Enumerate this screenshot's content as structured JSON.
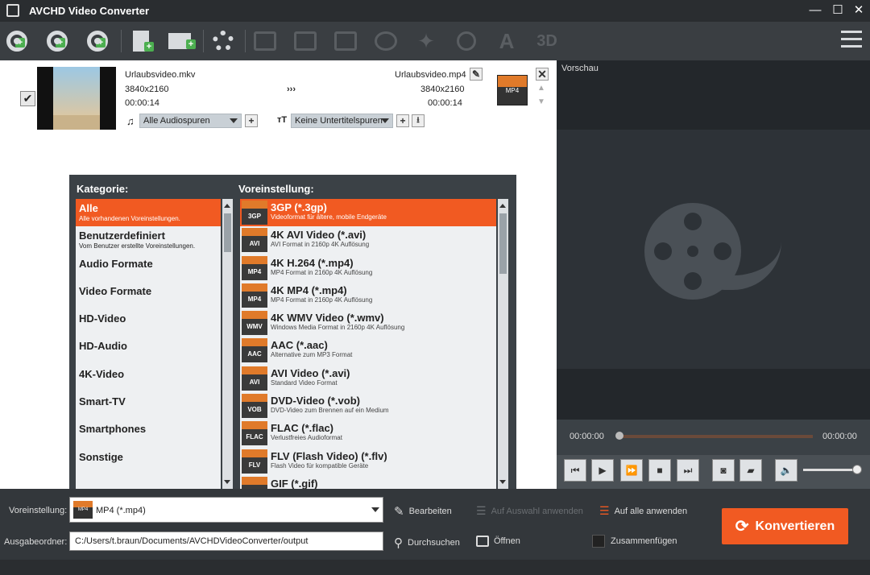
{
  "window": {
    "title": "AVCHD Video Converter",
    "min": "—",
    "max": "☐",
    "close": "✕"
  },
  "toolbar": {
    "icons": [
      "add-disc",
      "add-bluray",
      "add-iso",
      "add-file",
      "add-folder",
      "settings",
      "cut",
      "edit",
      "merge",
      "rotate",
      "effects",
      "contrast",
      "watermark",
      "3d"
    ]
  },
  "file": {
    "src_name": "Urlaubsvideo.mkv",
    "src_res": "3840x2160",
    "src_dur": "00:00:14",
    "arrow": "›››",
    "dst_name": "Urlaubsvideo.mp4",
    "dst_res": "3840x2160",
    "dst_dur": "00:00:14",
    "audio": "Alle Audiospuren",
    "subtitle": "Keine Untertitelspuren",
    "fmt_badge": "MP4",
    "checked": "✔"
  },
  "panel": {
    "cat_header": "Kategorie:",
    "preset_header": "Voreinstellung:",
    "categories": [
      {
        "name": "Alle",
        "sub": "Alle vorhandenen Voreinstellungen."
      },
      {
        "name": "Benutzerdefiniert",
        "sub": "Vom Benutzer erstellte Voreinstellungen."
      },
      {
        "name": "Audio Formate",
        "sub": ""
      },
      {
        "name": "Video Formate",
        "sub": ""
      },
      {
        "name": "HD-Video",
        "sub": ""
      },
      {
        "name": "HD-Audio",
        "sub": ""
      },
      {
        "name": "4K-Video",
        "sub": ""
      },
      {
        "name": "Smart-TV",
        "sub": ""
      },
      {
        "name": "Smartphones",
        "sub": ""
      },
      {
        "name": "Sonstige",
        "sub": ""
      }
    ],
    "presets": [
      {
        "badge": "3GP",
        "name": "3GP (*.3gp)",
        "desc": "Videoformat für ältere, mobile Endgeräte"
      },
      {
        "badge": "AVI",
        "name": "4K AVI Video (*.avi)",
        "desc": "AVI Format in 2160p 4K Auflösung"
      },
      {
        "badge": "MP4",
        "name": "4K H.264 (*.mp4)",
        "desc": "MP4 Format in 2160p 4K Auflösung"
      },
      {
        "badge": "MP4",
        "name": "4K MP4 (*.mp4)",
        "desc": "MP4 Format in 2160p 4K Auflösung"
      },
      {
        "badge": "WMV",
        "name": "4K WMV Video (*.wmv)",
        "desc": "Windows Media Format in 2160p 4K Auflösung"
      },
      {
        "badge": "AAC",
        "name": "AAC (*.aac)",
        "desc": "Alternative zum MP3 Format"
      },
      {
        "badge": "AVI",
        "name": "AVI Video (*.avi)",
        "desc": "Standard Video Format"
      },
      {
        "badge": "VOB",
        "name": "DVD-Video (*.vob)",
        "desc": "DVD-Video zum Brennen auf ein Medium"
      },
      {
        "badge": "FLAC",
        "name": "FLAC (*.flac)",
        "desc": "Verlustfreies Audioformat"
      },
      {
        "badge": "FLV",
        "name": "FLV (Flash Video) (*.flv)",
        "desc": "Flash Video für kompatible Geräte"
      },
      {
        "badge": "GIF",
        "name": "GIF (*.gif)",
        "desc": ""
      }
    ]
  },
  "preview": {
    "label": "Vorschau",
    "time_start": "00:00:00",
    "time_end": "00:00:00",
    "volume": 0.95
  },
  "bottom": {
    "preset_label": "Voreinstellung:",
    "preset_value": "MP4 (*.mp4)",
    "output_label": "Ausgabeordner:",
    "output_value": "C:/Users/t.braun/Documents/AVCHDVideoConverter/output",
    "edit": "Bearbeiten",
    "browse": "Durchsuchen",
    "open": "Öffnen",
    "apply_sel": "Auf Auswahl anwenden",
    "apply_all": "Auf alle anwenden",
    "merge": "Zusammenfügen",
    "convert": "Konvertieren"
  }
}
